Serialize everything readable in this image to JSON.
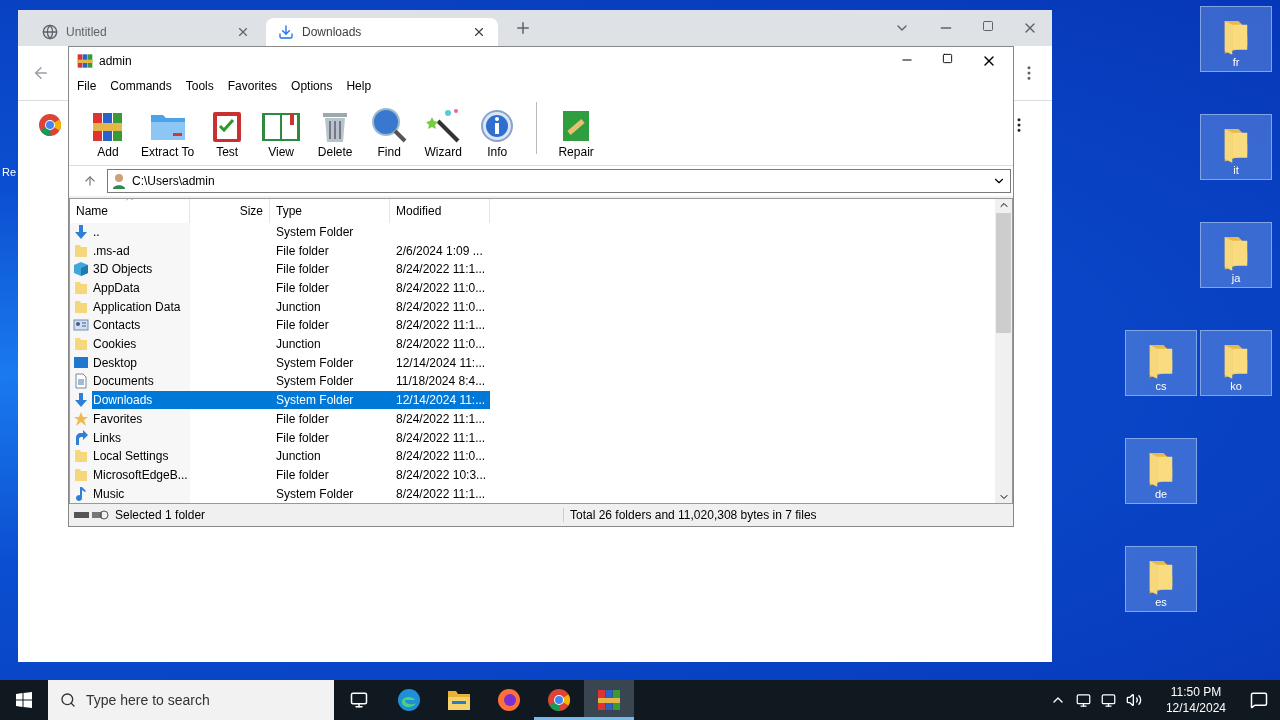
{
  "desktop": {
    "edge_label": "Re",
    "icons": [
      {
        "label": "fr"
      },
      {
        "label": "it"
      },
      {
        "label": "ja"
      },
      {
        "label": "cs"
      },
      {
        "label": "ko"
      },
      {
        "label": "de"
      },
      {
        "label": "es"
      }
    ]
  },
  "browser": {
    "tabs": [
      {
        "title": "Untitled",
        "selected": false
      },
      {
        "title": "Downloads",
        "selected": true
      }
    ]
  },
  "winrar": {
    "title": "admin",
    "menu": [
      "File",
      "Commands",
      "Tools",
      "Favorites",
      "Options",
      "Help"
    ],
    "toolbar": [
      "Add",
      "Extract To",
      "Test",
      "View",
      "Delete",
      "Find",
      "Wizard",
      "Info",
      "Repair"
    ],
    "address": "C:\\Users\\admin",
    "columns": [
      {
        "label": "Name",
        "sorted": true
      },
      {
        "label": "Size",
        "sorted": false
      },
      {
        "label": "Type",
        "sorted": false
      },
      {
        "label": "Modified",
        "sorted": false
      }
    ],
    "rows": [
      {
        "name": "..",
        "type": "System Folder",
        "selected": false
      },
      {
        "name": ".ms-ad",
        "type": "File folder",
        "modified": "2/6/2024 1:09 ...",
        "selected": false
      },
      {
        "name": "3D Objects",
        "type": "File folder",
        "modified": "8/24/2022 11:1...",
        "selected": false
      },
      {
        "name": "AppData",
        "type": "File folder",
        "modified": "8/24/2022 11:0...",
        "selected": false
      },
      {
        "name": "Application Data",
        "type": "Junction",
        "modified": "8/24/2022 11:0...",
        "selected": false
      },
      {
        "name": "Contacts",
        "type": "File folder",
        "modified": "8/24/2022 11:1...",
        "selected": false
      },
      {
        "name": "Cookies",
        "type": "Junction",
        "modified": "8/24/2022 11:0...",
        "selected": false
      },
      {
        "name": "Desktop",
        "type": "System Folder",
        "modified": "12/14/2024 11:...",
        "selected": false
      },
      {
        "name": "Documents",
        "type": "System Folder",
        "modified": "11/18/2024 8:4...",
        "selected": false
      },
      {
        "name": "Downloads",
        "type": "System Folder",
        "modified": "12/14/2024 11:...",
        "selected": true
      },
      {
        "name": "Favorites",
        "type": "File folder",
        "modified": "8/24/2022 11:1...",
        "selected": false
      },
      {
        "name": "Links",
        "type": "File folder",
        "modified": "8/24/2022 11:1...",
        "selected": false
      },
      {
        "name": "Local Settings",
        "type": "Junction",
        "modified": "8/24/2022 11:0...",
        "selected": false
      },
      {
        "name": "MicrosoftEdgeB...",
        "type": "File folder",
        "modified": "8/24/2022 10:3...",
        "selected": false
      },
      {
        "name": "Music",
        "type": "System Folder",
        "modified": "8/24/2022 11:1...",
        "selected": false
      }
    ],
    "status": {
      "selection": "Selected 1 folder",
      "total": "Total 26 folders and 11,020,308 bytes in 7 files"
    }
  },
  "taskbar": {
    "search_placeholder": "Type here to search",
    "apps": [
      {
        "running": false,
        "active": false
      },
      {
        "running": false,
        "active": false
      },
      {
        "running": false,
        "active": false
      },
      {
        "running": true,
        "active": false
      },
      {
        "running": true,
        "active": true
      }
    ],
    "time": "11:50 PM",
    "date": "12/14/2024"
  }
}
